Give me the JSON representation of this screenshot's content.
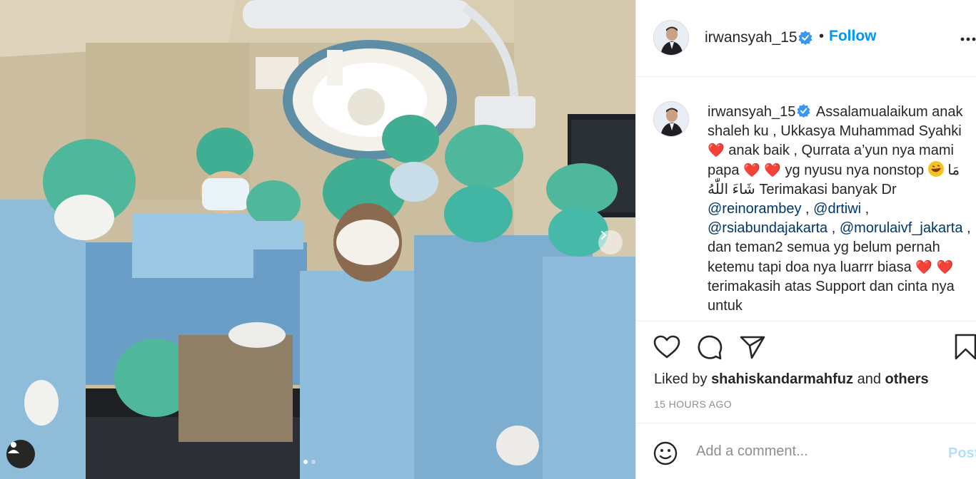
{
  "post": {
    "username": "irwansyah_15",
    "follow_label": "Follow",
    "bullet": "•",
    "caption": {
      "username": "irwansyah_15",
      "seg1": " Assalamualaikum anak shaleh ku , Ukkasya Muhammad Syahki ",
      "heart1": "❤️",
      "seg2": " anak baik , Qurrata a’yun nya mami papa ",
      "heart2": "❤️",
      "heart3": "❤️",
      "seg3": " yg nyusu nya nonstop ",
      "arabic": "مَا شَاءَ اللّٰهُ",
      "seg4": " Terimakasi banyak Dr ",
      "mention1": "@reinorambey",
      "sep1": " , ",
      "mention2": "@drtiwi",
      "sep2": " , ",
      "mention3": "@rsiabundajakarta",
      "sep3": " , ",
      "mention4": "@morulaivf_jakarta",
      "seg5": " , dan teman2 semua yg belum pernah ketemu tapi doa nya luarrr biasa ",
      "heart4": "❤️",
      "heart5": "❤️",
      "seg6": " terimakasih atas Support dan cinta nya untuk"
    },
    "liked_by_prefix": "Liked by ",
    "liked_by_user": "shahiskandarmahfuz",
    "liked_by_and": " and ",
    "liked_by_others": "others",
    "timestamp": "15 HOURS AGO",
    "comment_placeholder": "Add a comment...",
    "post_label": "Post"
  },
  "icons": {
    "verified": "verified-badge-icon",
    "more": "more-options-icon",
    "like": "heart-icon",
    "comment": "comment-icon",
    "share": "paper-plane-icon",
    "save": "bookmark-icon",
    "emoji": "smiley-icon",
    "next": "chevron-right-icon",
    "user_tag": "user-tag-icon"
  },
  "colors": {
    "follow_blue": "#0095f6",
    "mention_navy": "#00376b",
    "heart_red": "#e0132b",
    "secondary_gray": "#8e8e8e",
    "post_disabled": "#b2dffc"
  },
  "carousel": {
    "total_slides": 2,
    "active_index": 0
  }
}
